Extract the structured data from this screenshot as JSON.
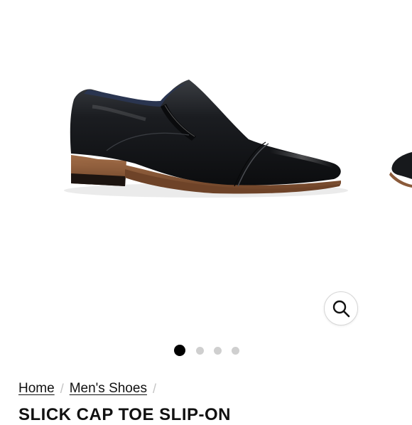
{
  "product_image": {
    "alt": "Black cap toe slip-on dress shoe",
    "active_slide": 1,
    "total_slides": 4,
    "colors": {
      "leather": "#17191c",
      "sole_wood": "#8a5a3a",
      "sole_dark": "#1c1410"
    }
  },
  "zoom_button": {
    "icon": "magnifier-icon"
  },
  "carousel": {
    "dots": [
      {
        "state": "active"
      },
      {
        "state": "inactive"
      },
      {
        "state": "inactive"
      },
      {
        "state": "inactive"
      }
    ]
  },
  "breadcrumb": {
    "items": [
      {
        "label": "Home"
      },
      {
        "label": "Men's Shoes"
      }
    ],
    "separator": "/"
  },
  "product": {
    "title": "SLICK CAP TOE SLIP-ON"
  }
}
